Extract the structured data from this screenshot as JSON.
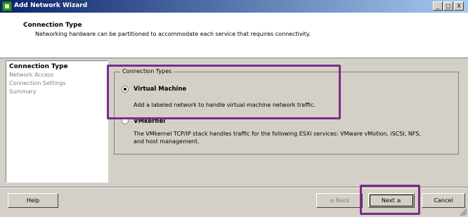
{
  "window": {
    "title": "Add Network Wizard",
    "controls": {
      "minimize": "_",
      "maximize": "□",
      "close": "X"
    }
  },
  "header": {
    "title": "Connection Type",
    "subtitle": "Networking hardware can be partitioned to accommodate each service that requires connectivity."
  },
  "nav": {
    "items": [
      {
        "label": "Connection Type",
        "active": true
      },
      {
        "label": "Network Access",
        "active": false
      },
      {
        "label": "Connection Settings",
        "active": false
      },
      {
        "label": "Summary",
        "active": false
      }
    ]
  },
  "connection_types": {
    "legend": "Connection Types",
    "options": [
      {
        "label": "Virtual Machine",
        "selected": true,
        "description": "Add a labeled network to handle virtual machine network traffic."
      },
      {
        "label": "VMkernel",
        "selected": false,
        "description_line1": "The VMkernel TCP/IP stack handles traffic for the following ESXi services: VMware vMotion, iSCSI, NFS,",
        "description_line2": "and host management."
      }
    ]
  },
  "buttons": {
    "help": "Help",
    "back": "≤ Back",
    "next": "Next ≥",
    "cancel": "Cancel"
  },
  "colors": {
    "highlight": "#7d2b8b",
    "titlebar_start": "#0a246a",
    "titlebar_end": "#a6caf0"
  }
}
